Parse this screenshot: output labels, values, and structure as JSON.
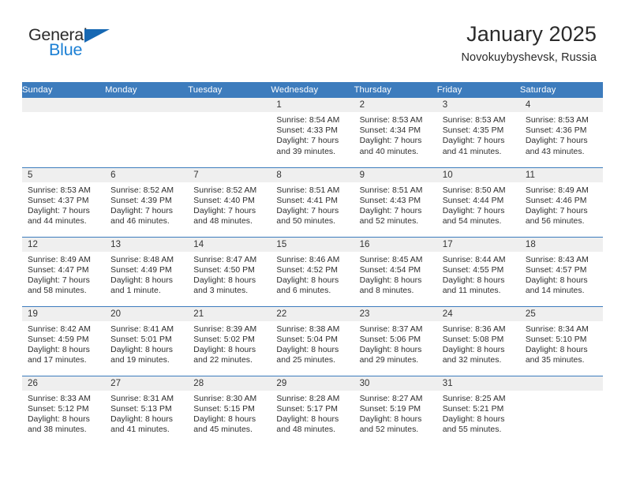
{
  "brand": {
    "word_one": "General",
    "word_two": "Blue",
    "color_dark": "#2a2a2a",
    "color_blue": "#1b7fd4",
    "flag_color": "#1668b3"
  },
  "header": {
    "title": "January 2025",
    "subtitle": "Novokuybyshevsk, Russia"
  },
  "theme": {
    "header_bg": "#3d7cbd",
    "header_text": "#ffffff",
    "daynum_band_bg": "#efefef",
    "row_rule": "#3d7cbd",
    "body_text": "#2d2d2d"
  },
  "weekday_headers": [
    "Sunday",
    "Monday",
    "Tuesday",
    "Wednesday",
    "Thursday",
    "Friday",
    "Saturday"
  ],
  "labels": {
    "sunrise_prefix": "Sunrise:",
    "sunset_prefix": "Sunset:",
    "daylight_prefix": "Daylight:"
  },
  "weeks": [
    [
      {
        "empty": true
      },
      {
        "empty": true
      },
      {
        "empty": true
      },
      {
        "day": "1",
        "sunrise": "Sunrise: 8:54 AM",
        "sunset": "Sunset: 4:33 PM",
        "daylight_1": "Daylight: 7 hours",
        "daylight_2": "and 39 minutes."
      },
      {
        "day": "2",
        "sunrise": "Sunrise: 8:53 AM",
        "sunset": "Sunset: 4:34 PM",
        "daylight_1": "Daylight: 7 hours",
        "daylight_2": "and 40 minutes."
      },
      {
        "day": "3",
        "sunrise": "Sunrise: 8:53 AM",
        "sunset": "Sunset: 4:35 PM",
        "daylight_1": "Daylight: 7 hours",
        "daylight_2": "and 41 minutes."
      },
      {
        "day": "4",
        "sunrise": "Sunrise: 8:53 AM",
        "sunset": "Sunset: 4:36 PM",
        "daylight_1": "Daylight: 7 hours",
        "daylight_2": "and 43 minutes."
      }
    ],
    [
      {
        "day": "5",
        "sunrise": "Sunrise: 8:53 AM",
        "sunset": "Sunset: 4:37 PM",
        "daylight_1": "Daylight: 7 hours",
        "daylight_2": "and 44 minutes."
      },
      {
        "day": "6",
        "sunrise": "Sunrise: 8:52 AM",
        "sunset": "Sunset: 4:39 PM",
        "daylight_1": "Daylight: 7 hours",
        "daylight_2": "and 46 minutes."
      },
      {
        "day": "7",
        "sunrise": "Sunrise: 8:52 AM",
        "sunset": "Sunset: 4:40 PM",
        "daylight_1": "Daylight: 7 hours",
        "daylight_2": "and 48 minutes."
      },
      {
        "day": "8",
        "sunrise": "Sunrise: 8:51 AM",
        "sunset": "Sunset: 4:41 PM",
        "daylight_1": "Daylight: 7 hours",
        "daylight_2": "and 50 minutes."
      },
      {
        "day": "9",
        "sunrise": "Sunrise: 8:51 AM",
        "sunset": "Sunset: 4:43 PM",
        "daylight_1": "Daylight: 7 hours",
        "daylight_2": "and 52 minutes."
      },
      {
        "day": "10",
        "sunrise": "Sunrise: 8:50 AM",
        "sunset": "Sunset: 4:44 PM",
        "daylight_1": "Daylight: 7 hours",
        "daylight_2": "and 54 minutes."
      },
      {
        "day": "11",
        "sunrise": "Sunrise: 8:49 AM",
        "sunset": "Sunset: 4:46 PM",
        "daylight_1": "Daylight: 7 hours",
        "daylight_2": "and 56 minutes."
      }
    ],
    [
      {
        "day": "12",
        "sunrise": "Sunrise: 8:49 AM",
        "sunset": "Sunset: 4:47 PM",
        "daylight_1": "Daylight: 7 hours",
        "daylight_2": "and 58 minutes."
      },
      {
        "day": "13",
        "sunrise": "Sunrise: 8:48 AM",
        "sunset": "Sunset: 4:49 PM",
        "daylight_1": "Daylight: 8 hours",
        "daylight_2": "and 1 minute."
      },
      {
        "day": "14",
        "sunrise": "Sunrise: 8:47 AM",
        "sunset": "Sunset: 4:50 PM",
        "daylight_1": "Daylight: 8 hours",
        "daylight_2": "and 3 minutes."
      },
      {
        "day": "15",
        "sunrise": "Sunrise: 8:46 AM",
        "sunset": "Sunset: 4:52 PM",
        "daylight_1": "Daylight: 8 hours",
        "daylight_2": "and 6 minutes."
      },
      {
        "day": "16",
        "sunrise": "Sunrise: 8:45 AM",
        "sunset": "Sunset: 4:54 PM",
        "daylight_1": "Daylight: 8 hours",
        "daylight_2": "and 8 minutes."
      },
      {
        "day": "17",
        "sunrise": "Sunrise: 8:44 AM",
        "sunset": "Sunset: 4:55 PM",
        "daylight_1": "Daylight: 8 hours",
        "daylight_2": "and 11 minutes."
      },
      {
        "day": "18",
        "sunrise": "Sunrise: 8:43 AM",
        "sunset": "Sunset: 4:57 PM",
        "daylight_1": "Daylight: 8 hours",
        "daylight_2": "and 14 minutes."
      }
    ],
    [
      {
        "day": "19",
        "sunrise": "Sunrise: 8:42 AM",
        "sunset": "Sunset: 4:59 PM",
        "daylight_1": "Daylight: 8 hours",
        "daylight_2": "and 17 minutes."
      },
      {
        "day": "20",
        "sunrise": "Sunrise: 8:41 AM",
        "sunset": "Sunset: 5:01 PM",
        "daylight_1": "Daylight: 8 hours",
        "daylight_2": "and 19 minutes."
      },
      {
        "day": "21",
        "sunrise": "Sunrise: 8:39 AM",
        "sunset": "Sunset: 5:02 PM",
        "daylight_1": "Daylight: 8 hours",
        "daylight_2": "and 22 minutes."
      },
      {
        "day": "22",
        "sunrise": "Sunrise: 8:38 AM",
        "sunset": "Sunset: 5:04 PM",
        "daylight_1": "Daylight: 8 hours",
        "daylight_2": "and 25 minutes."
      },
      {
        "day": "23",
        "sunrise": "Sunrise: 8:37 AM",
        "sunset": "Sunset: 5:06 PM",
        "daylight_1": "Daylight: 8 hours",
        "daylight_2": "and 29 minutes."
      },
      {
        "day": "24",
        "sunrise": "Sunrise: 8:36 AM",
        "sunset": "Sunset: 5:08 PM",
        "daylight_1": "Daylight: 8 hours",
        "daylight_2": "and 32 minutes."
      },
      {
        "day": "25",
        "sunrise": "Sunrise: 8:34 AM",
        "sunset": "Sunset: 5:10 PM",
        "daylight_1": "Daylight: 8 hours",
        "daylight_2": "and 35 minutes."
      }
    ],
    [
      {
        "day": "26",
        "sunrise": "Sunrise: 8:33 AM",
        "sunset": "Sunset: 5:12 PM",
        "daylight_1": "Daylight: 8 hours",
        "daylight_2": "and 38 minutes."
      },
      {
        "day": "27",
        "sunrise": "Sunrise: 8:31 AM",
        "sunset": "Sunset: 5:13 PM",
        "daylight_1": "Daylight: 8 hours",
        "daylight_2": "and 41 minutes."
      },
      {
        "day": "28",
        "sunrise": "Sunrise: 8:30 AM",
        "sunset": "Sunset: 5:15 PM",
        "daylight_1": "Daylight: 8 hours",
        "daylight_2": "and 45 minutes."
      },
      {
        "day": "29",
        "sunrise": "Sunrise: 8:28 AM",
        "sunset": "Sunset: 5:17 PM",
        "daylight_1": "Daylight: 8 hours",
        "daylight_2": "and 48 minutes."
      },
      {
        "day": "30",
        "sunrise": "Sunrise: 8:27 AM",
        "sunset": "Sunset: 5:19 PM",
        "daylight_1": "Daylight: 8 hours",
        "daylight_2": "and 52 minutes."
      },
      {
        "day": "31",
        "sunrise": "Sunrise: 8:25 AM",
        "sunset": "Sunset: 5:21 PM",
        "daylight_1": "Daylight: 8 hours",
        "daylight_2": "and 55 minutes."
      },
      {
        "empty": true
      }
    ]
  ]
}
